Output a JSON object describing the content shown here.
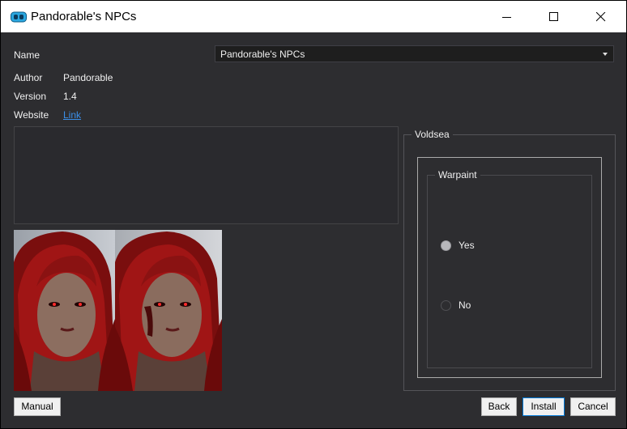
{
  "window": {
    "title": "Pandorable's NPCs"
  },
  "info": {
    "name_label": "Name",
    "name_value": "Pandorable's NPCs",
    "author_label": "Author",
    "author_value": "Pandorable",
    "version_label": "Version",
    "version_value": "1.4",
    "website_label": "Website",
    "website_link": "Link"
  },
  "options": {
    "group_title": "Voldsea",
    "subgroup_title": "Warpaint",
    "choices": [
      {
        "label": "Yes",
        "selected": true
      },
      {
        "label": "No",
        "selected": false
      }
    ]
  },
  "buttons": {
    "manual": "Manual",
    "back": "Back",
    "install": "Install",
    "cancel": "Cancel"
  },
  "colors": {
    "background": "#2d2d30",
    "accent": "#0078d7",
    "link": "#3b8fe8"
  }
}
